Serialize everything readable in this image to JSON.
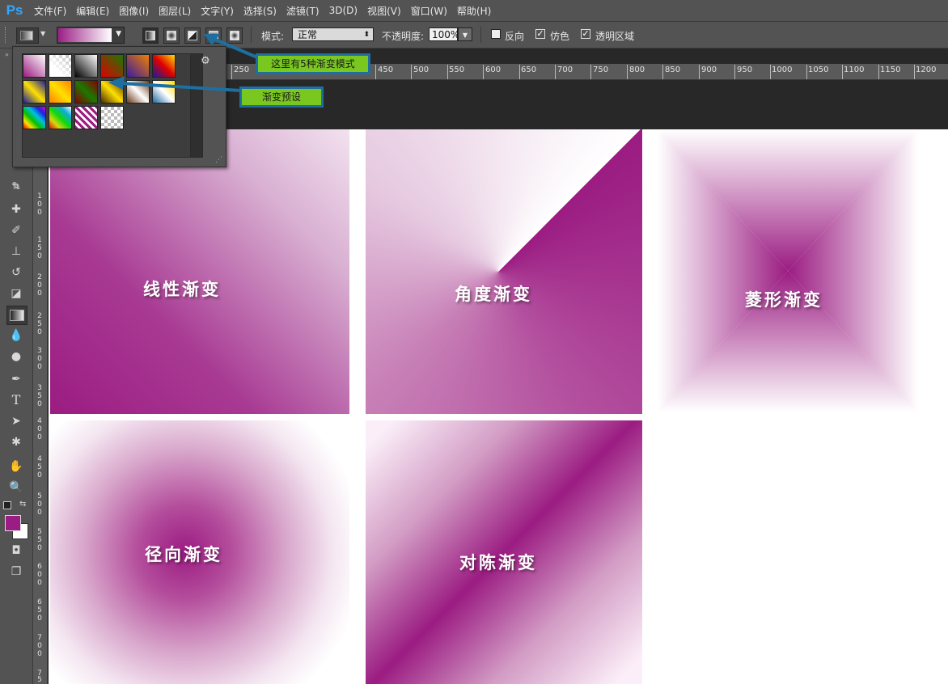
{
  "app": {
    "logo": "Ps"
  },
  "menu": [
    "文件(F)",
    "编辑(E)",
    "图像(I)",
    "图层(L)",
    "文字(Y)",
    "选择(S)",
    "滤镜(T)",
    "3D(D)",
    "视图(V)",
    "窗口(W)",
    "帮助(H)"
  ],
  "options": {
    "mode_label": "模式:",
    "mode_value": "正常",
    "opacity_label": "不透明度:",
    "opacity_value": "100%",
    "reverse_label": "反向",
    "dither_label": "仿色",
    "transparency_label": "透明区域"
  },
  "ruler": {
    "top": [
      "250",
      "450",
      "500",
      "550",
      "600",
      "650",
      "700",
      "750",
      "800",
      "850",
      "900",
      "950",
      "1000",
      "1050",
      "1100",
      "1150",
      "1200"
    ],
    "left": [
      "1",
      "0",
      "0",
      "1",
      "5",
      "0",
      "2",
      "0",
      "0",
      "2",
      "5",
      "0",
      "3",
      "0",
      "0",
      "3",
      "5",
      "0",
      "4",
      "0",
      "0",
      "4",
      "5",
      "0",
      "5",
      "0",
      "0",
      "5",
      "5",
      "0",
      "6",
      "0",
      "0",
      "6",
      "5",
      "0",
      "7",
      "0",
      "0",
      "7",
      "5"
    ]
  },
  "panels": {
    "linear": "线性渐变",
    "angle": "角度渐变",
    "diamond": "菱形渐变",
    "radial": "径向渐变",
    "reflected": "对陈渐变"
  },
  "callouts": {
    "modes": "这里有5种渐变模式",
    "presets": "渐变预设"
  },
  "colors": {
    "foreground": "#9b1c82",
    "background": "#ffffff",
    "callout_fill": "#7ac720",
    "callout_border": "#1e6fa0"
  },
  "tools": [
    "move-icon",
    "marquee-icon",
    "lasso-icon",
    "quick-select-icon",
    "crop-icon",
    "eyedropper-icon",
    "healing-brush-icon",
    "brush-icon",
    "clone-stamp-icon",
    "history-brush-icon",
    "eraser-icon",
    "gradient-icon",
    "blur-icon",
    "dodge-icon",
    "pen-icon",
    "type-icon",
    "path-select-icon",
    "shape-icon",
    "hand-icon",
    "zoom-icon"
  ]
}
